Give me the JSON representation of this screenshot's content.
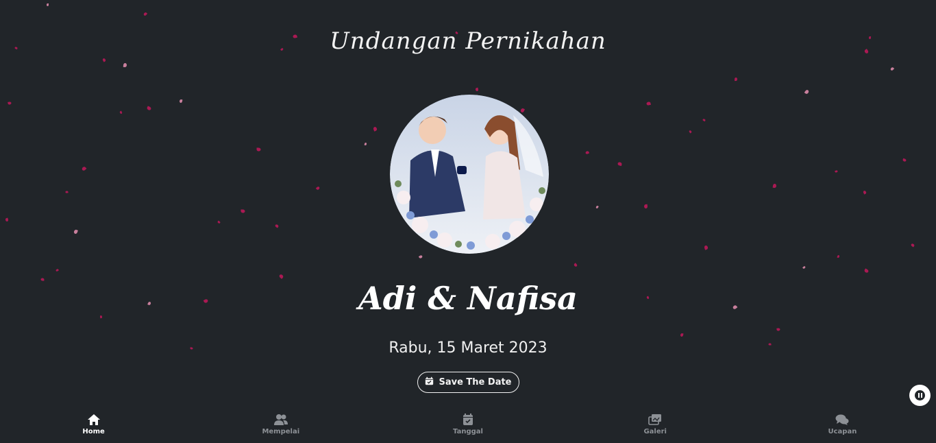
{
  "header": {
    "title": "Undangan Pernikahan"
  },
  "couple": {
    "names": "Adi & Nafisa"
  },
  "event": {
    "date": "Rabu, 15 Maret 2023"
  },
  "save_button": {
    "label": "Save The Date",
    "icon": "calendar-check-icon"
  },
  "music_button": {
    "icon": "pause-icon"
  },
  "nav": {
    "items": [
      {
        "label": "Home",
        "icon": "home-icon",
        "active": true
      },
      {
        "label": "Mempelai",
        "icon": "users-icon",
        "active": false
      },
      {
        "label": "Tanggal",
        "icon": "calendar-check-icon",
        "active": false
      },
      {
        "label": "Galeri",
        "icon": "images-icon",
        "active": false
      },
      {
        "label": "Ucapan",
        "icon": "comments-icon",
        "active": false
      }
    ]
  },
  "colors": {
    "background": "#212529",
    "petal": "#c2185b",
    "text": "#ffffff",
    "nav_inactive": "#8d9196"
  }
}
